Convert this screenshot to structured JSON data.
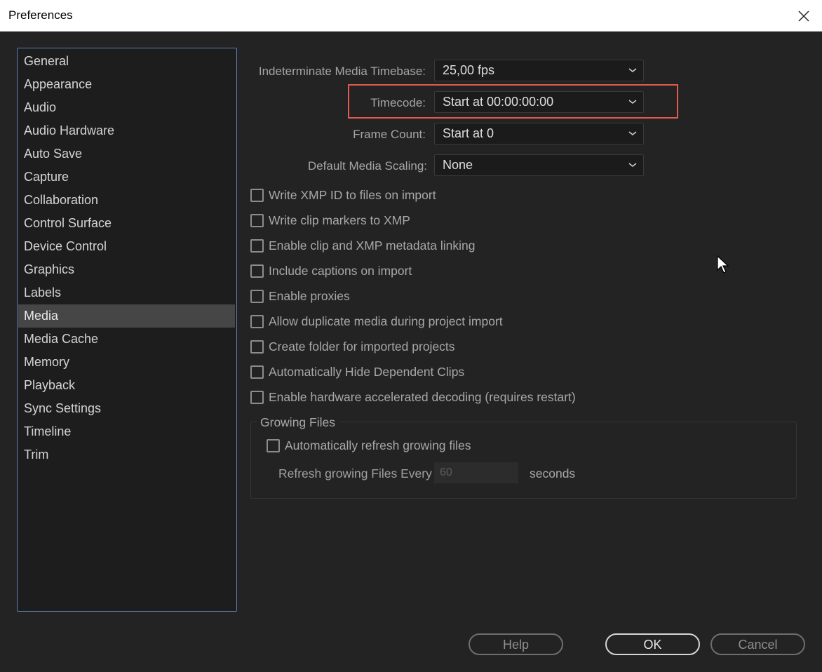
{
  "window": {
    "title": "Preferences",
    "close_icon": "close-icon"
  },
  "sidebar": {
    "selected": "Media",
    "items": [
      {
        "label": "General"
      },
      {
        "label": "Appearance"
      },
      {
        "label": "Audio"
      },
      {
        "label": "Audio Hardware"
      },
      {
        "label": "Auto Save"
      },
      {
        "label": "Capture"
      },
      {
        "label": "Collaboration"
      },
      {
        "label": "Control Surface"
      },
      {
        "label": "Device Control"
      },
      {
        "label": "Graphics"
      },
      {
        "label": "Labels"
      },
      {
        "label": "Media"
      },
      {
        "label": "Media Cache"
      },
      {
        "label": "Memory"
      },
      {
        "label": "Playback"
      },
      {
        "label": "Sync Settings"
      },
      {
        "label": "Timeline"
      },
      {
        "label": "Trim"
      }
    ]
  },
  "settings": {
    "timebase": {
      "label": "Indeterminate Media Timebase:",
      "value": "25,00 fps"
    },
    "timecode": {
      "label": "Timecode:",
      "value": "Start at 00:00:00:00"
    },
    "frame_count": {
      "label": "Frame Count:",
      "value": "Start at 0"
    },
    "scaling": {
      "label": "Default Media Scaling:",
      "value": "None"
    }
  },
  "checkboxes": [
    {
      "label": "Write XMP ID to files on import",
      "checked": false
    },
    {
      "label": "Write clip markers to XMP",
      "checked": false
    },
    {
      "label": "Enable clip and XMP metadata linking",
      "checked": false
    },
    {
      "label": "Include captions on import",
      "checked": false
    },
    {
      "label": "Enable proxies",
      "checked": false
    },
    {
      "label": "Allow duplicate media during project import",
      "checked": false
    },
    {
      "label": "Create folder for imported projects",
      "checked": false
    },
    {
      "label": "Automatically Hide Dependent Clips",
      "checked": false
    },
    {
      "label": "Enable hardware accelerated decoding (requires restart)",
      "checked": false
    }
  ],
  "growing_files": {
    "title": "Growing Files",
    "auto_refresh": {
      "label": "Automatically refresh growing files",
      "checked": false
    },
    "refresh_label": "Refresh growing Files Every",
    "refresh_value": "60",
    "refresh_unit": "seconds"
  },
  "buttons": {
    "help": "Help",
    "ok": "OK",
    "cancel": "Cancel"
  },
  "colors": {
    "highlight": "#e05a4e",
    "selected_item": "#464646",
    "sidebar_border": "#5a7fb6"
  }
}
